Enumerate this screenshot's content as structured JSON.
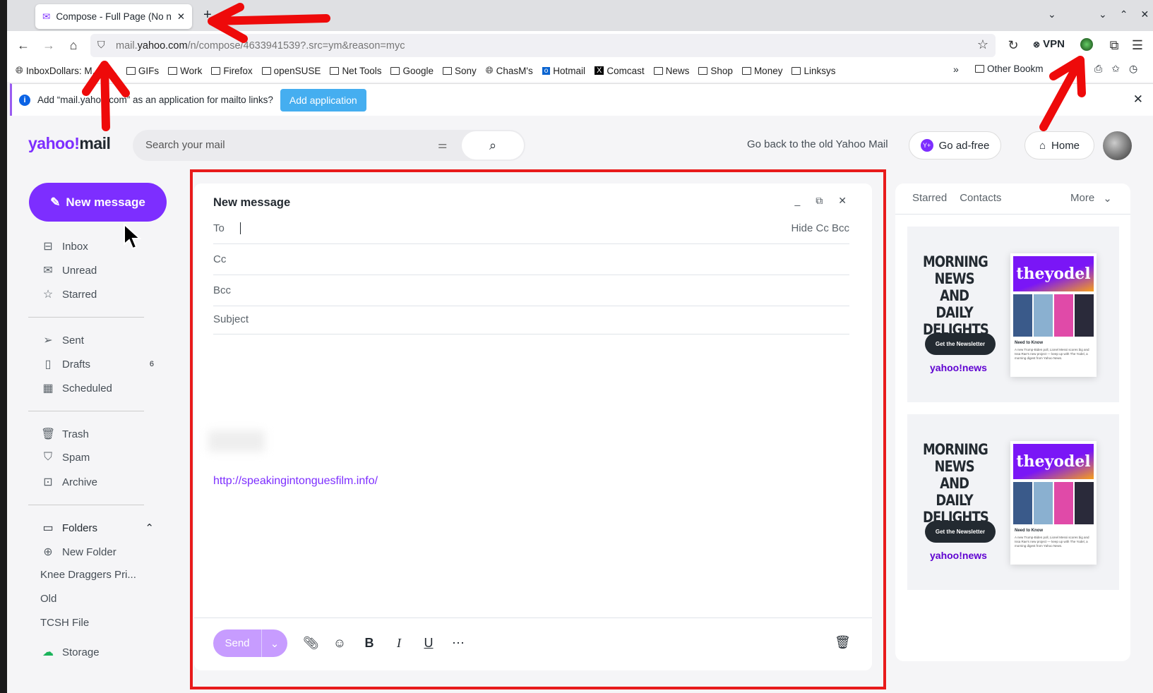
{
  "browser": {
    "tab_title": "Compose - Full Page (No n",
    "url_prefix": "mail.",
    "url_domain": "yahoo.com",
    "url_rest": "/n/compose/4633941539?.src=ym&reason=myc",
    "vpn_label": "VPN",
    "bookmarks": [
      "InboxDollars: M... E...",
      "GIFs",
      "Work",
      "Firefox",
      "openSUSE",
      "Net Tools",
      "Google",
      "Sony",
      "ChasM's",
      "Hotmail",
      "Comcast",
      "News",
      "Shop",
      "Money",
      "Linksys"
    ],
    "other_bookmarks": "Other Bookm",
    "notification": {
      "text": "Add “mail.yahoo.com” as an application for mailto links?",
      "button": "Add application"
    }
  },
  "header": {
    "logo": "yahoo!mail",
    "search_placeholder": "Search your mail",
    "old_mail_link": "Go back to the old Yahoo Mail",
    "ad_free": "Go ad-free",
    "home": "Home"
  },
  "sidebar": {
    "new_message": "New message",
    "groups": [
      [
        {
          "label": "Inbox"
        },
        {
          "label": "Unread"
        },
        {
          "label": "Starred"
        }
      ],
      [
        {
          "label": "Sent"
        },
        {
          "label": "Drafts",
          "count": "6"
        },
        {
          "label": "Scheduled"
        }
      ],
      [
        {
          "label": "Trash"
        },
        {
          "label": "Spam"
        },
        {
          "label": "Archive"
        }
      ]
    ],
    "folders_label": "Folders",
    "new_folder": "New Folder",
    "folders": [
      "Knee Draggers Pri...",
      "Old",
      "TCSH File"
    ],
    "storage": "Storage"
  },
  "compose": {
    "title": "New message",
    "to_label": "To",
    "hide_cc_bcc": "Hide Cc Bcc",
    "cc_label": "Cc",
    "bcc_label": "Bcc",
    "subject_placeholder": "Subject",
    "body_link": "http://speakingintonguesfilm.info/",
    "send": "Send"
  },
  "right_panel": {
    "tabs": [
      "Starred",
      "Contacts"
    ],
    "more": "More",
    "ads": [
      {
        "headline": "MORNING NEWS AND DAILY DELIGHTS",
        "button": "Get the Newsletter",
        "brand": "yahoo!news",
        "preview_title": "theyodel",
        "preview_heading": "Need to Know",
        "preview_text": "A new Trump-Biden poll, Lionel Messi scores big and Issa Rae's new project — keep up with The Yodel, a morning digest from Yahoo News."
      },
      {
        "headline": "MORNING NEWS AND DAILY DELIGHTS",
        "button": "Get the Newsletter",
        "brand": "yahoo!news",
        "preview_title": "theyodel",
        "preview_heading": "Need to Know",
        "preview_text": "A new Trump-Biden poll, Lionel Messi scores big and Issa Rae's new project — keep up with The Yodel, a morning digest from Yahoo News."
      }
    ]
  },
  "colors": {
    "accent": "#7d2eff",
    "annotation": "#e81b1b"
  }
}
